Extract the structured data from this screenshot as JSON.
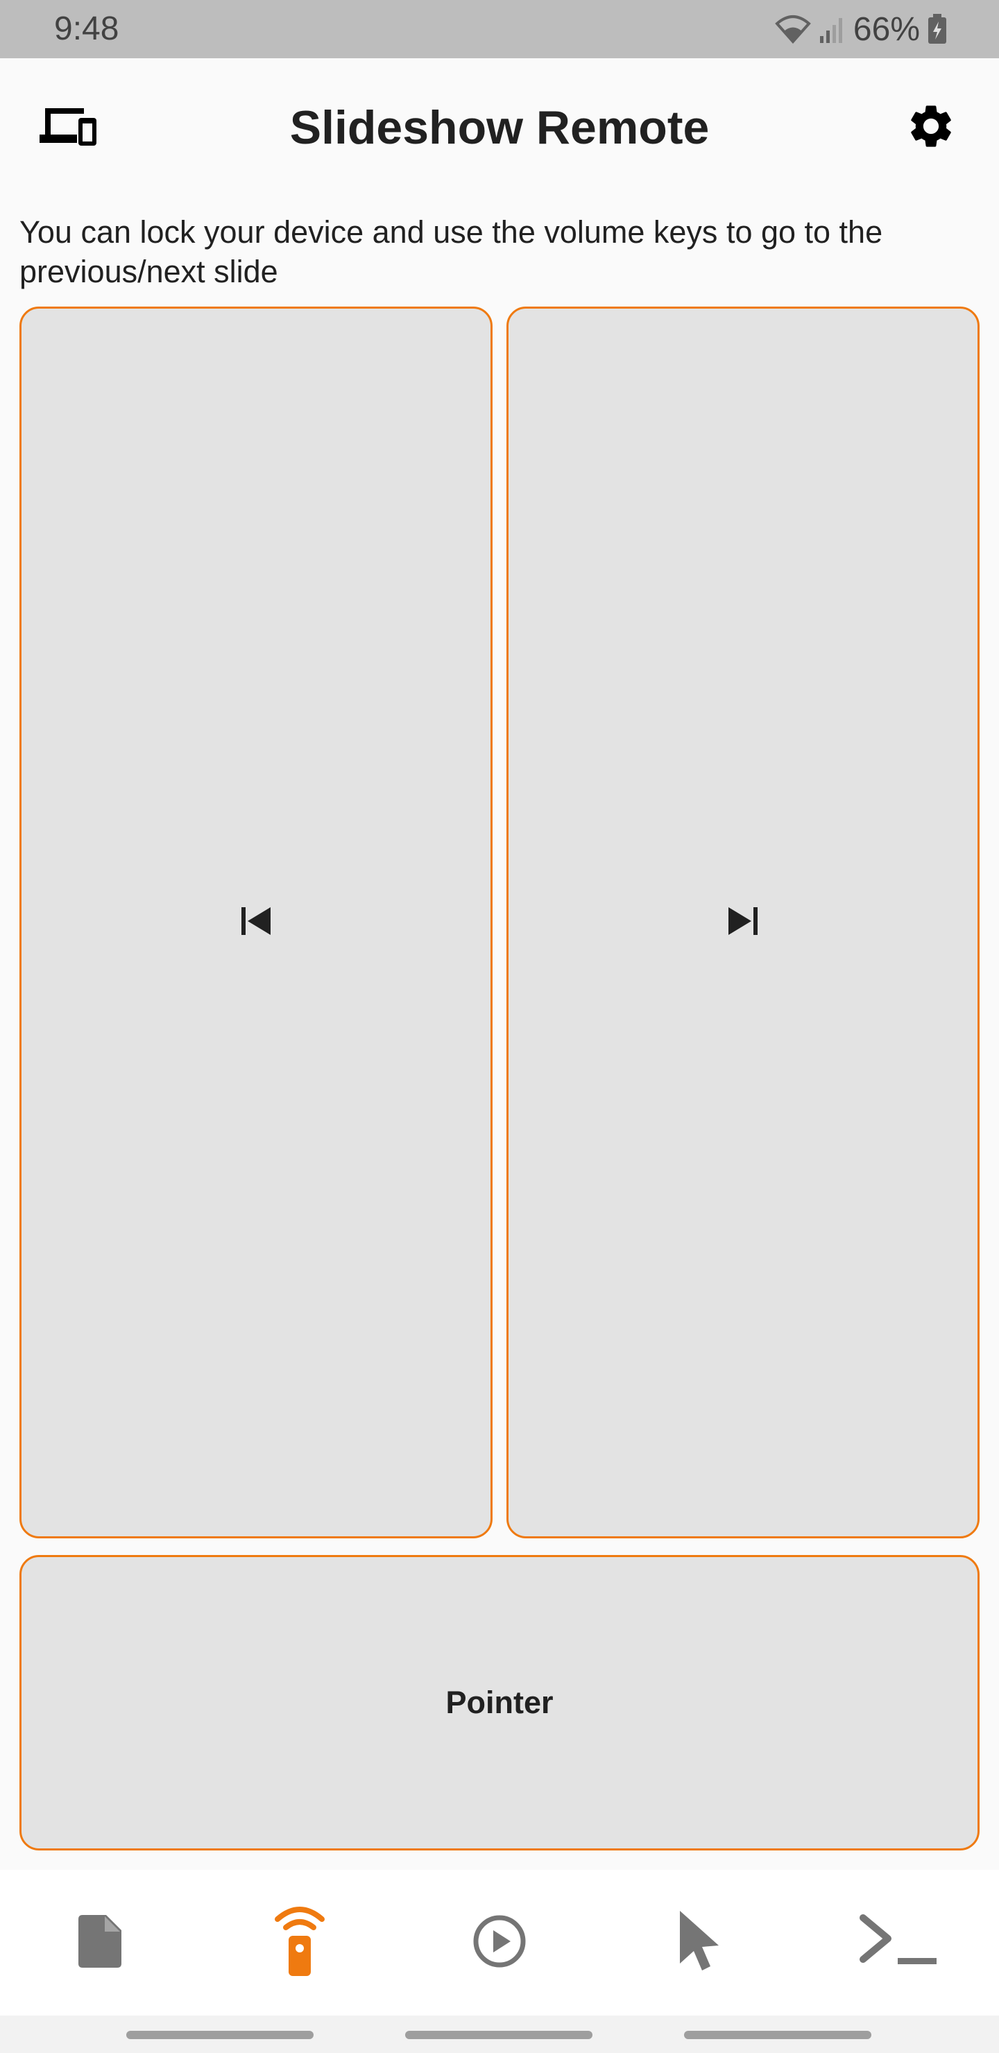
{
  "status_bar": {
    "time": "9:48",
    "battery": "66%",
    "icons": [
      "wifi-icon",
      "signal-icon",
      "battery-charging-icon"
    ]
  },
  "app_bar": {
    "title": "Slideshow Remote",
    "left_icon": "devices-icon",
    "right_icon": "settings-gear-icon"
  },
  "hint": "You can lock your device and use the volume keys to go to the previous/next slide",
  "pads": {
    "previous_icon": "skip-previous-icon",
    "next_icon": "skip-next-icon",
    "pointer_label": "Pointer"
  },
  "bottom_nav": {
    "items": [
      {
        "icon": "file-icon",
        "active": false
      },
      {
        "icon": "remote-icon",
        "active": true
      },
      {
        "icon": "play-circle-icon",
        "active": false
      },
      {
        "icon": "cursor-icon",
        "active": false
      },
      {
        "icon": "terminal-icon",
        "active": false
      }
    ]
  },
  "colors": {
    "accent": "#ef7a10",
    "pad_fill": "#e3e3e3",
    "inactive_icon": "#757575",
    "text": "#212121",
    "status_bar": "#bdbdbd"
  }
}
